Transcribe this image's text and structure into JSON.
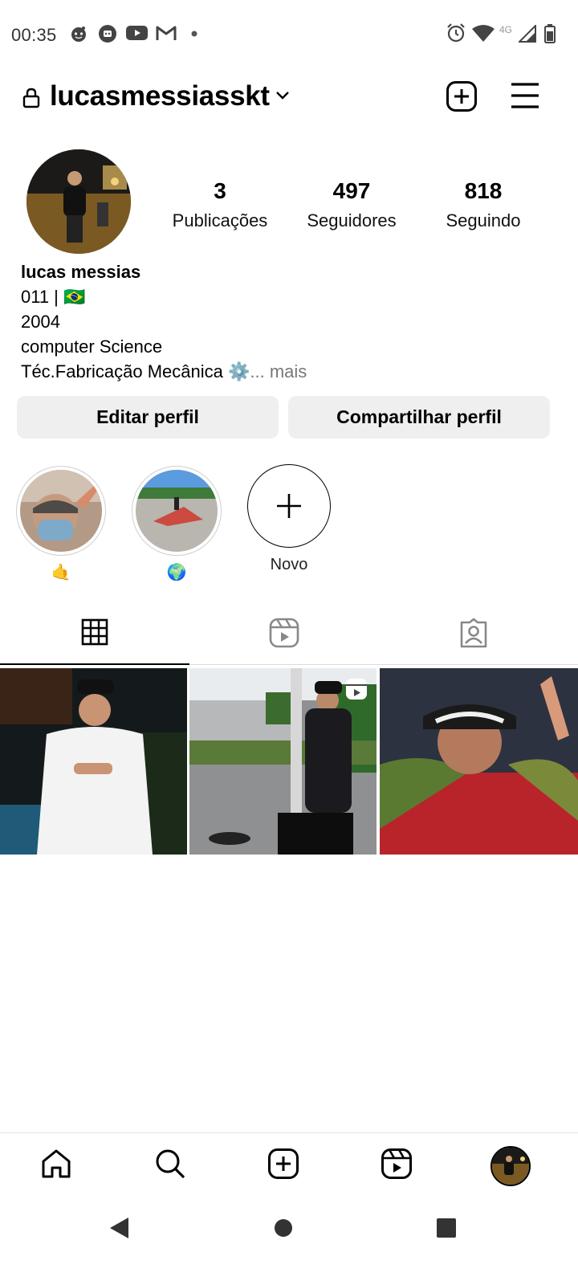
{
  "status_bar": {
    "time": "00:35",
    "network": "4G",
    "icons": [
      "reddit-icon",
      "discord-icon",
      "youtube-icon",
      "gmail-icon",
      "notification-dot-icon",
      "alarm-icon",
      "wifi-icon",
      "cell-signal-icon",
      "battery-icon"
    ]
  },
  "header": {
    "username": "lucasmessiasskt",
    "icons": [
      "lock-icon",
      "chevron-down-icon",
      "create-post-icon",
      "menu-icon"
    ]
  },
  "profile": {
    "stats": [
      {
        "value": "3",
        "label": "Publicações"
      },
      {
        "value": "497",
        "label": "Seguidores"
      },
      {
        "value": "818",
        "label": "Seguindo"
      }
    ],
    "name": "lucas messias",
    "bio_line1_text": "011 |",
    "bio_line1_flag": "🇧🇷",
    "bio_line2": "2004",
    "bio_line3": "computer Science",
    "bio_line4_text": "Téc.Fabricação Mecânica ⚙️",
    "bio_more": "... mais"
  },
  "buttons": {
    "edit": "Editar perfil",
    "share": "Compartilhar perfil"
  },
  "highlights": [
    {
      "caption": "🤙"
    },
    {
      "caption": "🌍"
    },
    {
      "caption": "Novo"
    }
  ],
  "tabs": {
    "icons": [
      "grid-icon",
      "reels-icon",
      "tagged-icon"
    ],
    "active": "grid"
  },
  "bottom_nav": {
    "icons": [
      "home-icon",
      "search-icon",
      "create-icon",
      "reels-icon",
      "profile-avatar"
    ]
  },
  "colors": {
    "button_bg": "#efefef",
    "divider": "#dbdbdb",
    "text_primary": "#000000",
    "text_muted": "#777777"
  }
}
